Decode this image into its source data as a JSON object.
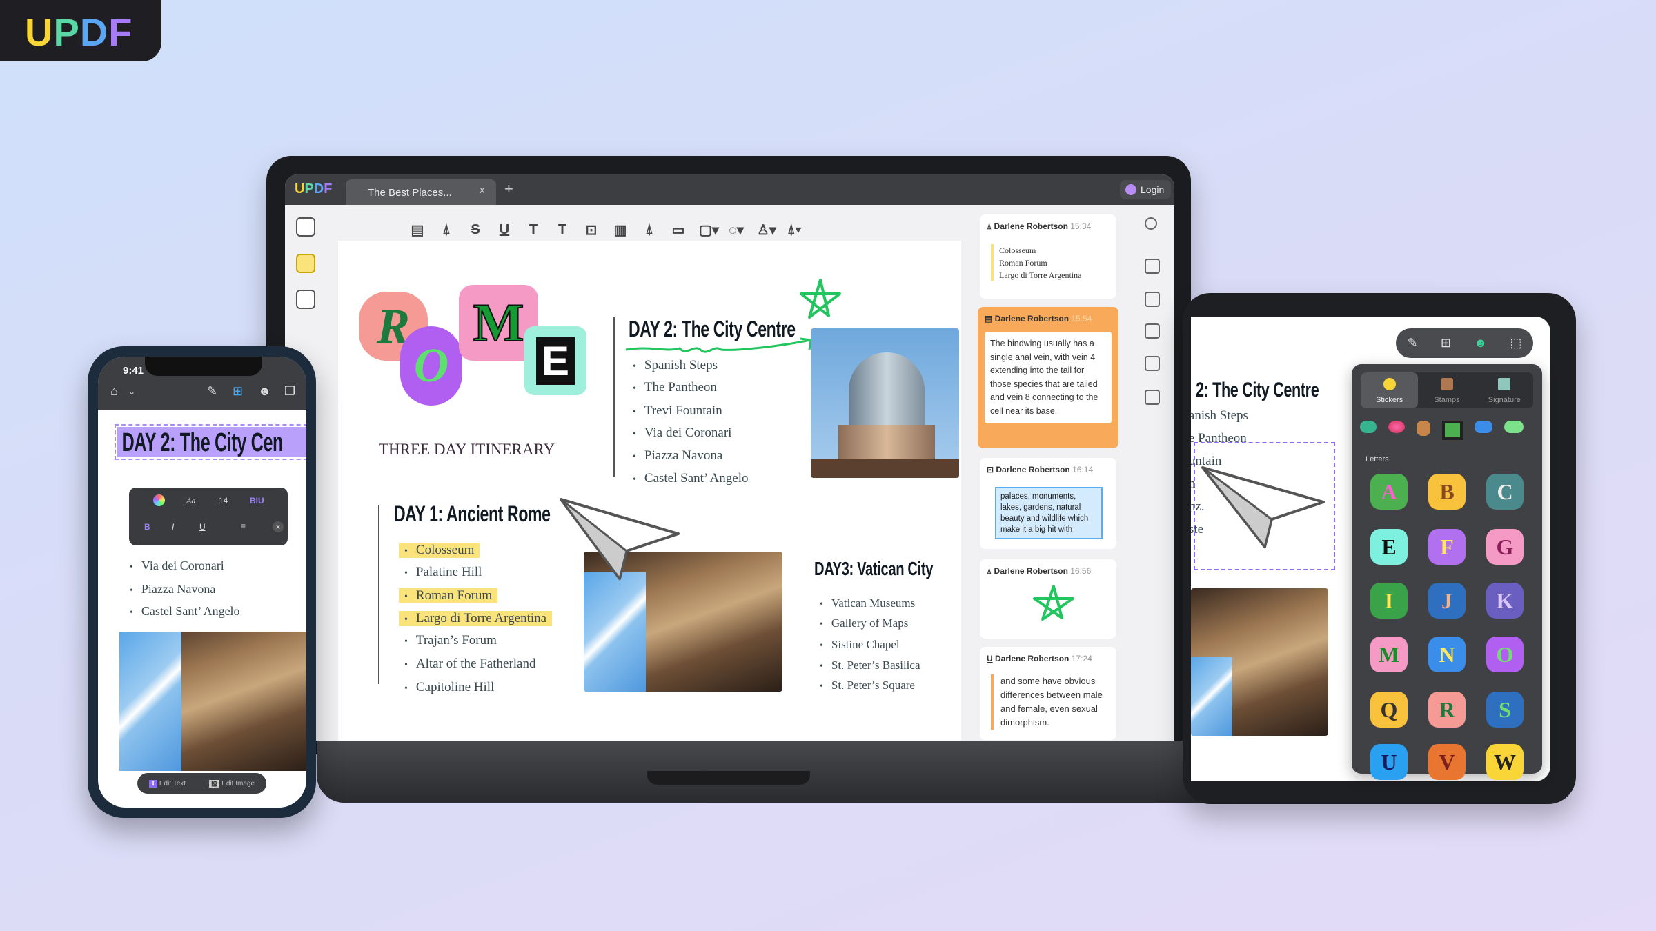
{
  "brand": {
    "logo_letters": [
      "U",
      "P",
      "D",
      "F"
    ]
  },
  "laptop": {
    "app_logo": "UPDF",
    "tab_title": "The Best Places...",
    "tab_close": "x",
    "tab_add": "+",
    "login_label": "Login",
    "toolbar_icons": [
      "comment-icon",
      "highlight-icon",
      "strikethrough-icon",
      "underline-icon",
      "squiggly-icon",
      "text-icon",
      "textbox-icon",
      "text-callout-icon",
      "pencil-icon",
      "eraser-icon",
      "shape-icon",
      "lasso-icon",
      "stamp-icon",
      "signature-icon"
    ],
    "toolbar_glyphs": [
      "▤",
      "⍋",
      "S",
      "U",
      "T",
      "T",
      "⊡",
      "▥",
      "⍋",
      "▭",
      "▢▾",
      "◌▾",
      "♙▾",
      "⍋▾"
    ],
    "page": {
      "rome_letters": [
        "R",
        "O",
        "M",
        "E"
      ],
      "subtitle": "THREE DAY ITINERARY",
      "day2": {
        "title": "DAY 2: The City Centre",
        "items": [
          "Spanish Steps",
          "The Pantheon",
          "Trevi Fountain",
          "Via dei Coronari",
          "Piazza Navona",
          "Castel Sant’ Angelo"
        ]
      },
      "day1": {
        "title": "DAY 1: Ancient Rome",
        "items": [
          {
            "text": "Colosseum",
            "highlighted": true
          },
          {
            "text": "Palatine Hill",
            "highlighted": false
          },
          {
            "text": "Roman Forum",
            "highlighted": true
          },
          {
            "text": "Largo di Torre Argentina",
            "highlighted": true
          },
          {
            "text": "Trajan’s Forum",
            "highlighted": false
          },
          {
            "text": "Altar of the Fatherland",
            "highlighted": false
          },
          {
            "text": "Capitoline Hill",
            "highlighted": false
          }
        ]
      },
      "day3": {
        "title": "DAY3: Vatican City",
        "items": [
          "Vatican Museums",
          "Gallery of Maps",
          "Sistine Chapel",
          "St. Peter’s Basilica",
          "St. Peter’s Square"
        ]
      }
    },
    "comments": [
      {
        "author": "Darlene Robertson",
        "time": "15:34",
        "type": "highlight",
        "items": [
          "Colosseum",
          "Roman Forum",
          "Largo di Torre Argentina"
        ]
      },
      {
        "author": "Darlene Robertson",
        "time": "15:54",
        "type": "note",
        "text": "The hindwing usually has a single anal vein, with vein 4 extending into the tail for those species that are tailed and vein 8 connecting to the cell near its base."
      },
      {
        "author": "Darlene Robertson",
        "time": "16:14",
        "type": "textbox",
        "text": "palaces, monuments, lakes, gardens, natural beauty and wildlife which make it a big hit with"
      },
      {
        "author": "Darlene Robertson",
        "time": "16:56",
        "type": "pencil"
      },
      {
        "author": "Darlene Robertson",
        "time": "17:24",
        "type": "underline",
        "text": "and some have obvious differences between male and female, even sexual dimorphism."
      }
    ]
  },
  "tablet": {
    "heading": "2: The City Centre",
    "items": [
      "anish Steps",
      "e Pantheon",
      "untain",
      "n",
      "nz.",
      "ste"
    ],
    "tabs": [
      "Stickers",
      "Stamps",
      "Signature"
    ],
    "section_label": "Letters",
    "letters": [
      "A",
      "B",
      "C",
      "E",
      "F",
      "G",
      "I",
      "J",
      "K",
      "M",
      "N",
      "O",
      "Q",
      "R",
      "S",
      "U",
      "V",
      "W"
    ]
  },
  "phone": {
    "time": "9:41",
    "heading": "DAY 2: The City Cen",
    "format_bar": {
      "font_label": "Aa",
      "size": "14",
      "style_label": "BIU",
      "bold": "B",
      "italic": "I",
      "underline": "U",
      "close": "×"
    },
    "items": [
      "Via dei Coronari",
      "Piazza Navona",
      "Castel Sant’ Angelo"
    ],
    "edit_text": "Edit Text",
    "edit_image": "Edit Image"
  },
  "colors": {
    "accent_orange": "#f9a95a",
    "highlight_yellow": "#fae37a",
    "star_green": "#22c55e",
    "selection_purple": "#b9a0fb"
  }
}
